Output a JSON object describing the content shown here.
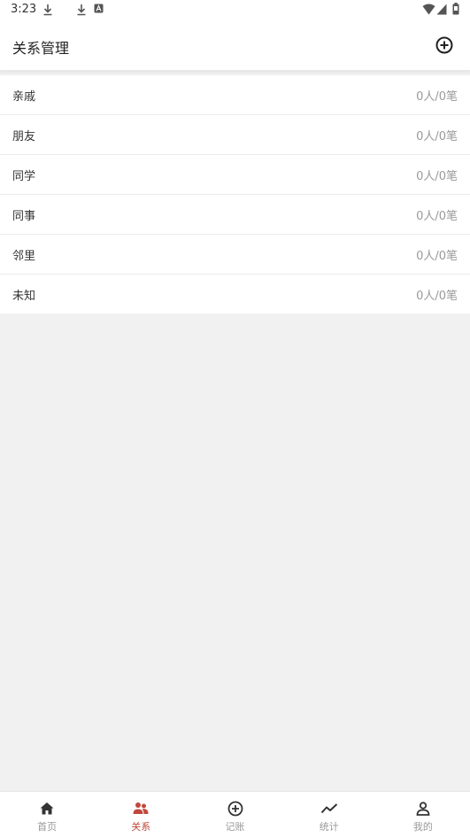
{
  "status": {
    "time": "3:23"
  },
  "header": {
    "title": "关系管理"
  },
  "relations": [
    {
      "name": "亲戚",
      "count": "0人/0笔"
    },
    {
      "name": "朋友",
      "count": "0人/0笔"
    },
    {
      "name": "同学",
      "count": "0人/0笔"
    },
    {
      "name": "同事",
      "count": "0人/0笔"
    },
    {
      "name": "邻里",
      "count": "0人/0笔"
    },
    {
      "name": "未知",
      "count": "0人/0笔"
    }
  ],
  "tabs": [
    {
      "label": "首页",
      "icon": "home-icon"
    },
    {
      "label": "关系",
      "icon": "people-icon",
      "active": true
    },
    {
      "label": "记账",
      "icon": "add-circle-icon"
    },
    {
      "label": "统计",
      "icon": "trend-icon"
    },
    {
      "label": "我的",
      "icon": "user-icon"
    }
  ],
  "colors": {
    "accent": "#c0483c",
    "inactive": "#999999",
    "background": "#f1f1f1"
  }
}
